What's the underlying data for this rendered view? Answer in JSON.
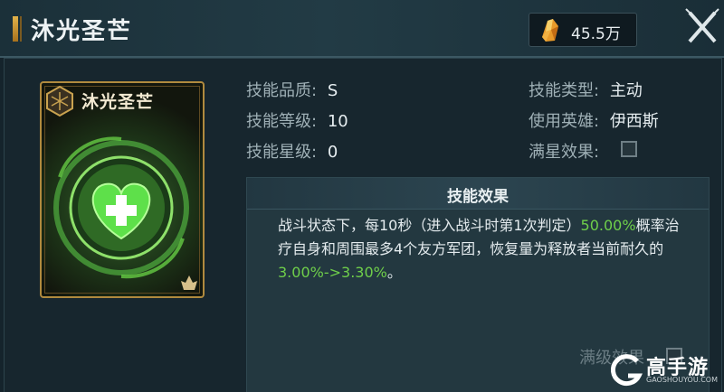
{
  "header": {
    "title": "沐光圣芒",
    "currency_value": "45.5万"
  },
  "card": {
    "name": "沐光圣芒"
  },
  "info": {
    "quality_label": "技能品质:",
    "quality_value": "S",
    "level_label": "技能等级:",
    "level_value": "10",
    "star_label": "技能星级:",
    "star_value": "0",
    "type_label": "技能类型:",
    "type_value": "主动",
    "hero_label": "使用英雄:",
    "hero_value": "伊西斯",
    "maxstar_label": "满星效果:"
  },
  "effect": {
    "title": "技能效果",
    "text_1": "战斗状态下，每10秒（进入战斗时第1次判定）",
    "chance": "50.00%",
    "text_2": "概率治疗自身和周围最多4个友方军团，恢复量为释放者当前耐久的",
    "heal_range": "3.00%->3.30%",
    "text_3": "。"
  },
  "footer": {
    "max_level_label": "满级效果"
  },
  "watermark": {
    "brand": "高手游",
    "domain": "GAOSHOUYOU.COM"
  },
  "colors": {
    "accent_green": "#6fcf4a",
    "gold": "#b08a3e"
  },
  "icons": [
    "crystal-icon",
    "close-icon",
    "emblem-icon",
    "heal-heart-icon",
    "corner-icon",
    "g-logo-icon"
  ]
}
